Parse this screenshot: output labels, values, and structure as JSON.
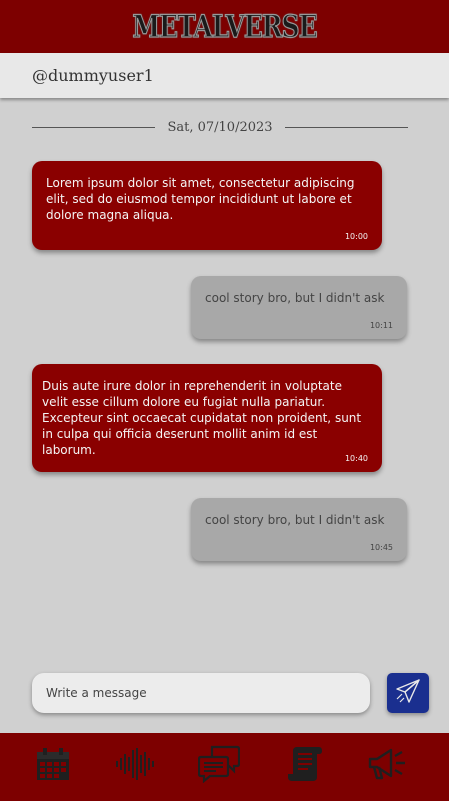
{
  "header": {
    "logo_text": "METALVERSE"
  },
  "chat": {
    "username": "@dummyuser1",
    "date": "Sat, 07/10/2023",
    "messages": [
      {
        "direction": "incoming",
        "text": "Lorem ipsum dolor sit amet, consectetur adipiscing elit, sed do eiusmod tempor incididunt ut labore et dolore magna aliqua.",
        "time": "10:00"
      },
      {
        "direction": "outgoing",
        "text": "cool story bro, but I didn't ask",
        "time": "10:11"
      },
      {
        "direction": "incoming",
        "text": "Duis aute irure dolor in reprehenderit in voluptate velit esse cillum dolore eu fugiat nulla pariatur. Excepteur sint occaecat cupidatat non proident, sunt in culpa qui officia deserunt mollit anim id est laborum.",
        "time": "10:40"
      },
      {
        "direction": "outgoing",
        "text": "cool story bro, but I didn't ask",
        "time": "10:45"
      }
    ]
  },
  "composer": {
    "placeholder": "Write a message",
    "value": ""
  },
  "bottom_nav": [
    {
      "icon": "calendar-icon"
    },
    {
      "icon": "audio-wave-icon"
    },
    {
      "icon": "chat-bubbles-icon"
    },
    {
      "icon": "scroll-icon"
    },
    {
      "icon": "megaphone-icon"
    }
  ],
  "colors": {
    "bar_red": "#7d0000",
    "incoming_bubble": "#8a0000",
    "outgoing_bubble": "#a8a8a8",
    "background": "#d0d0d0",
    "send_button": "#1a2f8f"
  }
}
